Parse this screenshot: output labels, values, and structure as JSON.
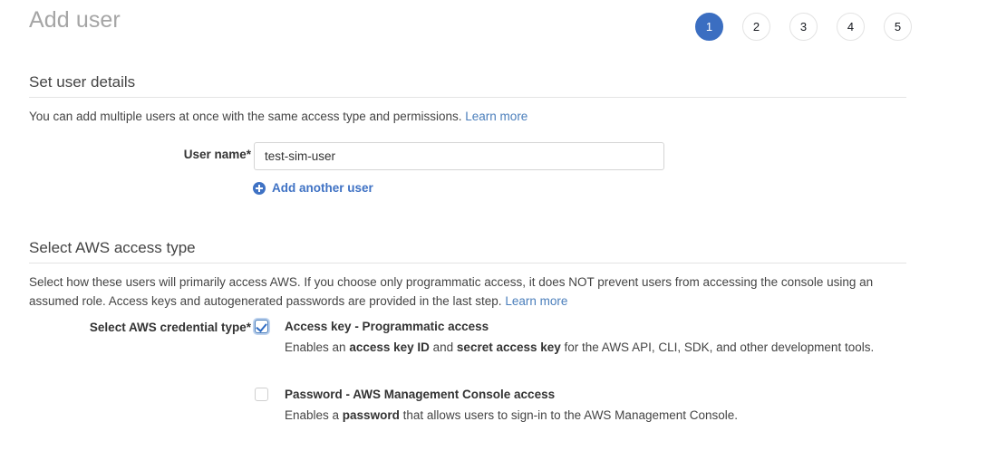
{
  "header": {
    "title": "Add user",
    "steps": [
      {
        "label": "1",
        "active": true
      },
      {
        "label": "2",
        "active": false
      },
      {
        "label": "3",
        "active": false
      },
      {
        "label": "4",
        "active": false
      },
      {
        "label": "5",
        "active": false
      }
    ]
  },
  "user_details": {
    "section_title": "Set user details",
    "description": "You can add multiple users at once with the same access type and permissions.",
    "learn_more_label": "Learn more",
    "user_name_label": "User name*",
    "user_name_value": "test-sim-user",
    "user_name_placeholder": "",
    "add_another_user_label": "Add another user",
    "add_icon": "plus-circle-icon"
  },
  "access_type": {
    "section_title": "Select AWS access type",
    "description": "Select how these users will primarily access AWS. If you choose only programmatic access, it does NOT prevent users from accessing the console using an assumed role. Access keys and autogenerated passwords are provided in the last step.",
    "learn_more_label": "Learn more",
    "credential_type_label": "Select AWS credential type*",
    "options": [
      {
        "id": "access-key",
        "checked": true,
        "title": "Access key - Programmatic access",
        "desc_parts": [
          {
            "text": "Enables an ",
            "bold": false
          },
          {
            "text": "access key ID",
            "bold": true
          },
          {
            "text": " and ",
            "bold": false
          },
          {
            "text": "secret access key",
            "bold": true
          },
          {
            "text": " for the AWS API, CLI, SDK, and other development tools.",
            "bold": false
          }
        ]
      },
      {
        "id": "password",
        "checked": false,
        "title": "Password - AWS Management Console access",
        "desc_parts": [
          {
            "text": "Enables a ",
            "bold": false
          },
          {
            "text": "password",
            "bold": true
          },
          {
            "text": " that allows users to sign-in to the AWS Management Console.",
            "bold": false
          }
        ]
      }
    ]
  },
  "colors": {
    "accent_blue": "#3b6ec1",
    "link_blue": "#4a7ebb",
    "divider_gray": "#e4e4e4",
    "title_gray": "#a5a5a5",
    "text_dark": "#333333"
  }
}
